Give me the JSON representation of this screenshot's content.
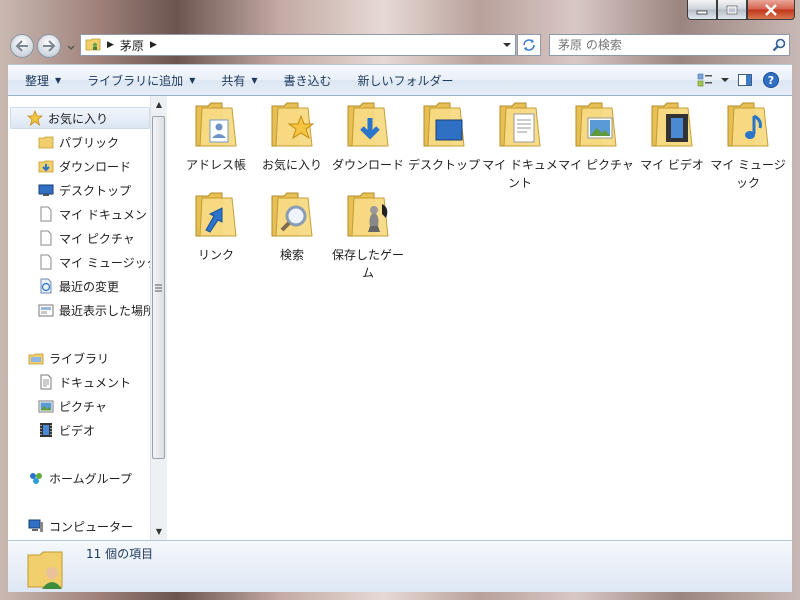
{
  "address": {
    "crumb": "茅原"
  },
  "search": {
    "placeholder": "茅原 の検索"
  },
  "toolbar": {
    "organize": "整理",
    "include_library": "ライブラリに追加",
    "share": "共有",
    "burn": "書き込む",
    "new_folder": "新しいフォルダー"
  },
  "nav": {
    "favorites": "お気に入り",
    "public": "パブリック",
    "downloads": "ダウンロード",
    "desktop": "デスクトップ",
    "my_documents": "マイ ドキュメント",
    "my_pictures": "マイ ピクチャ",
    "my_music": "マイ ミュージック",
    "recent_changes": "最近の変更",
    "recent_places": "最近表示した場所",
    "libraries": "ライブラリ",
    "documents": "ドキュメント",
    "pictures": "ピクチャ",
    "videos": "ビデオ",
    "homegroup": "ホームグループ",
    "computer": "コンピューター"
  },
  "files": [
    {
      "label": "アドレス帳",
      "icon": "contacts-folder-icon"
    },
    {
      "label": "お気に入り",
      "icon": "favorites-folder-icon"
    },
    {
      "label": "ダウンロード",
      "icon": "downloads-folder-icon"
    },
    {
      "label": "デスクトップ",
      "icon": "desktop-folder-icon"
    },
    {
      "label": "マイ ドキュメント",
      "icon": "documents-folder-icon"
    },
    {
      "label": "マイ ピクチャ",
      "icon": "pictures-folder-icon"
    },
    {
      "label": "マイ ビデオ",
      "icon": "videos-folder-icon"
    },
    {
      "label": "マイ ミュージック",
      "icon": "music-folder-icon"
    },
    {
      "label": "リンク",
      "icon": "links-folder-icon"
    },
    {
      "label": "検索",
      "icon": "searches-folder-icon"
    },
    {
      "label": "保存したゲーム",
      "icon": "saved-games-folder-icon"
    }
  ],
  "status": {
    "count": "11 個の項目"
  },
  "colors": {
    "folder": "#f2cf6d",
    "toolbar_text": "#1e395b",
    "accent_blue": "#2a74c9"
  }
}
